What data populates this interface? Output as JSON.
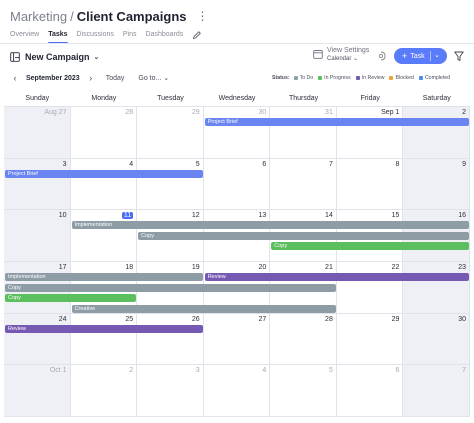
{
  "breadcrumb": {
    "parent": "Marketing",
    "separator": "/",
    "title": "Client Campaigns"
  },
  "tabs": [
    {
      "label": "Overview",
      "active": false
    },
    {
      "label": "Tasks",
      "active": true
    },
    {
      "label": "Discussions",
      "active": false
    },
    {
      "label": "Pins",
      "active": false
    },
    {
      "label": "Dashboards",
      "active": false
    }
  ],
  "toolbar": {
    "view_name": "New Campaign",
    "view_settings_title": "View Settings",
    "view_settings_sub": "Calendar",
    "add_label": "Task"
  },
  "nav": {
    "month": "September 2023",
    "today": "Today",
    "goto": "Go to..."
  },
  "legend": {
    "label": "Status:",
    "items": [
      {
        "label": "To Do",
        "color": "#8fa0aa"
      },
      {
        "label": "In Progress",
        "color": "#5cbf5e"
      },
      {
        "label": "In Review",
        "color": "#7559b3"
      },
      {
        "label": "Blocked",
        "color": "#f0a23a"
      },
      {
        "label": "Completed",
        "color": "#4a8df0"
      }
    ]
  },
  "weekdays": [
    "Sunday",
    "Monday",
    "Tuesday",
    "Wednesday",
    "Thursday",
    "Friday",
    "Saturday"
  ],
  "weeks": [
    [
      "Aug 27",
      "28",
      "29",
      "30",
      "31",
      "Sep 1",
      "2"
    ],
    [
      "3",
      "4",
      "5",
      "6",
      "7",
      "8",
      "9"
    ],
    [
      "10",
      "11",
      "12",
      "13",
      "14",
      "15",
      "16"
    ],
    [
      "17",
      "18",
      "19",
      "20",
      "21",
      "22",
      "23"
    ],
    [
      "24",
      "25",
      "26",
      "27",
      "28",
      "29",
      "30"
    ],
    [
      "Oct 1",
      "2",
      "3",
      "4",
      "5",
      "6",
      "7"
    ]
  ],
  "other_month": [
    [
      true,
      true,
      true,
      true,
      true,
      false,
      false
    ],
    [
      false,
      false,
      false,
      false,
      false,
      false,
      false
    ],
    [
      false,
      false,
      false,
      false,
      false,
      false,
      false
    ],
    [
      false,
      false,
      false,
      false,
      false,
      false,
      false
    ],
    [
      false,
      false,
      false,
      false,
      false,
      false,
      false
    ],
    [
      true,
      true,
      true,
      true,
      true,
      true,
      true
    ]
  ],
  "today": "11",
  "colors": {
    "blue": "#6a85f2",
    "gray": "#8e9ca6",
    "green": "#5cbf5e",
    "purple": "#7559b3"
  },
  "events": [
    {
      "label": "Project Brief",
      "color": "blue",
      "week": 0,
      "start": 3,
      "end": 6,
      "lane": 0
    },
    {
      "label": "Project Brief",
      "color": "blue",
      "week": 1,
      "start": 0,
      "end": 2,
      "lane": 0
    },
    {
      "label": "Implementation",
      "color": "gray",
      "week": 2,
      "start": 1,
      "end": 6,
      "lane": 0
    },
    {
      "label": "Copy",
      "color": "gray",
      "week": 2,
      "start": 2,
      "end": 6,
      "lane": 1
    },
    {
      "label": "Copy",
      "color": "green",
      "week": 2,
      "start": 4,
      "end": 6,
      "lane": 2
    },
    {
      "label": "Implementation",
      "color": "gray",
      "week": 3,
      "start": 0,
      "end": 2,
      "lane": 0
    },
    {
      "label": "Review",
      "color": "purple",
      "week": 3,
      "start": 3,
      "end": 6,
      "lane": 0
    },
    {
      "label": "Copy",
      "color": "gray",
      "week": 3,
      "start": 0,
      "end": 4,
      "lane": 1
    },
    {
      "label": "Copy",
      "color": "green",
      "week": 3,
      "start": 0,
      "end": 1,
      "lane": 2
    },
    {
      "label": "Creative",
      "color": "gray",
      "week": 3,
      "start": 1,
      "end": 4,
      "lane": 3
    },
    {
      "label": "Review",
      "color": "purple",
      "week": 4,
      "start": 0,
      "end": 2,
      "lane": 0
    }
  ]
}
